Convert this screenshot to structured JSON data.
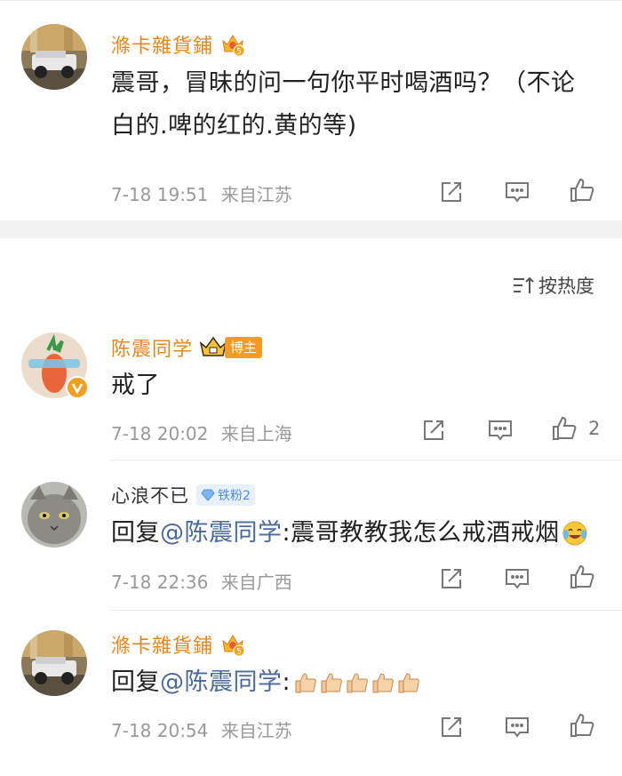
{
  "comment1": {
    "username": "滌卡雜貨鋪",
    "text_line1": "震哥，冒昧的问一句你平时喝酒吗？（不论",
    "text_line2": "白的.啤的红的.黄的等)",
    "time": "7-18 19:51",
    "location": "来自江苏"
  },
  "sort": {
    "label": "按热度"
  },
  "comment2": {
    "username": "陈震同学",
    "badge": "博主",
    "text": "戒了",
    "time": "7-18 20:02",
    "location": "来自上海",
    "likes": "2"
  },
  "reply1": {
    "username": "心浪不已",
    "fan_badge": "铁粉2",
    "prefix": "回复",
    "mention": "@陈震同学",
    "text": ":震哥教教我怎么戒酒戒烟",
    "time": "7-18 22:36",
    "location": "来自广西"
  },
  "reply2": {
    "username": "滌卡雜貨鋪",
    "prefix": "回复",
    "mention": "@陈震同学",
    "text": ":",
    "time": "7-18 20:54",
    "location": "来自江苏"
  },
  "colors": {
    "username": "#e5871f",
    "mention": "#4a6a9a",
    "meta": "#999999",
    "separator": "#f2f2f2"
  },
  "icons": [
    "share-icon",
    "comment-icon",
    "like-icon",
    "sort-icon",
    "crown-badge-icon",
    "verified-icon",
    "thumbs-up-emoji",
    "laugh-cry-emoji"
  ]
}
